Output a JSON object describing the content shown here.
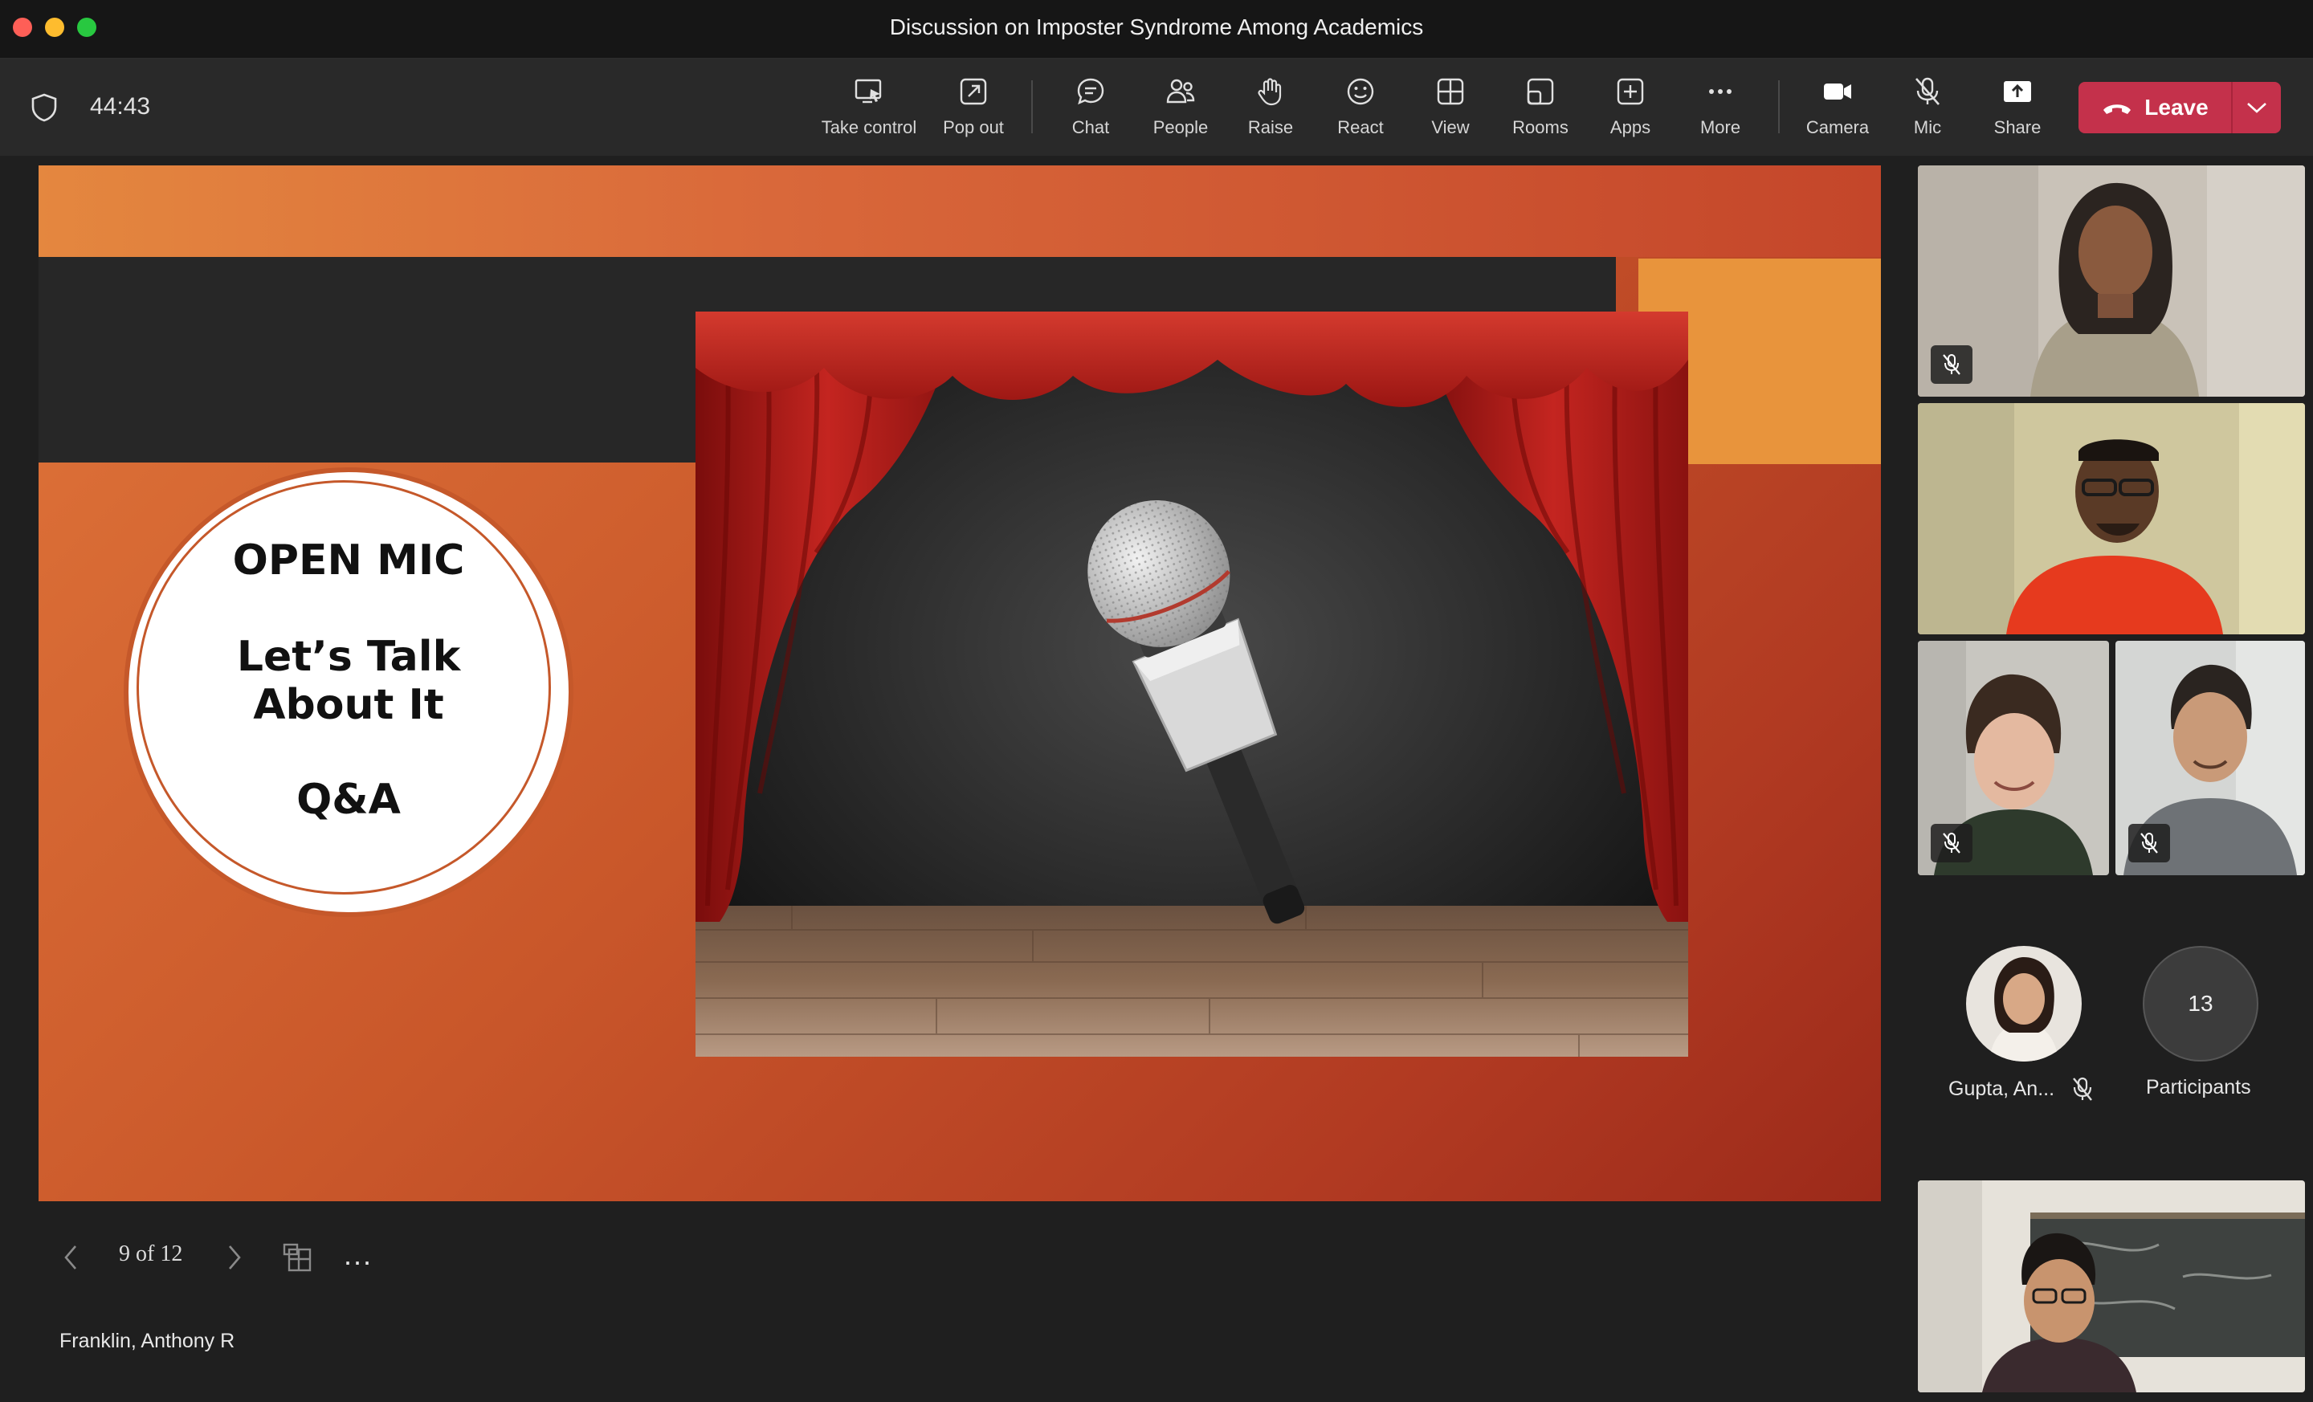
{
  "window": {
    "title": "Discussion on Imposter Syndrome Among Academics"
  },
  "meeting": {
    "timer": "44:43"
  },
  "toolbar": {
    "take_control": "Take control",
    "pop_out": "Pop out",
    "chat": "Chat",
    "people": "People",
    "raise": "Raise",
    "react": "React",
    "view": "View",
    "rooms": "Rooms",
    "apps": "Apps",
    "more": "More",
    "camera": "Camera",
    "mic": "Mic",
    "share": "Share",
    "leave": "Leave"
  },
  "slide": {
    "line1": "OPEN MIC",
    "line2": "Let’s Talk",
    "line3": "About It",
    "line4": "Q&A"
  },
  "slide_controls": {
    "page": "9 of 12",
    "more": "..."
  },
  "presenter": {
    "name": "Franklin, Anthony R"
  },
  "participants": {
    "avatar_name": "Gupta, An...",
    "count": "13",
    "count_label": "Participants"
  },
  "colors": {
    "leave": "#c4314b",
    "slide_orange": "#d9683a",
    "slide_dark_band": "#272727",
    "accent_box": "#e8943c",
    "curtain_red": "#b01e1c"
  }
}
